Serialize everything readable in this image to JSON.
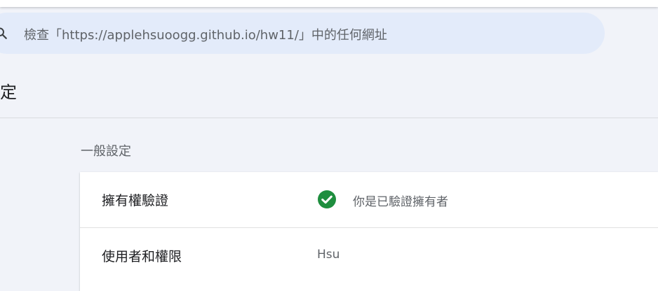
{
  "search": {
    "text": "檢查「https://applehsuoogg.github.io/hw11/」中的任何網址"
  },
  "page": {
    "title": "定"
  },
  "section": {
    "title": "一般設定"
  },
  "settings": {
    "rows": [
      {
        "label": "擁有權驗證",
        "value": "你是已驗證擁有者",
        "icon": "check-circle-icon"
      },
      {
        "label": "使用者和權限",
        "value": "Hsu"
      }
    ]
  },
  "colors": {
    "search_bg": "#e3ebfa",
    "page_bg": "#f1f3f9",
    "check_green": "#1e8e3e"
  }
}
